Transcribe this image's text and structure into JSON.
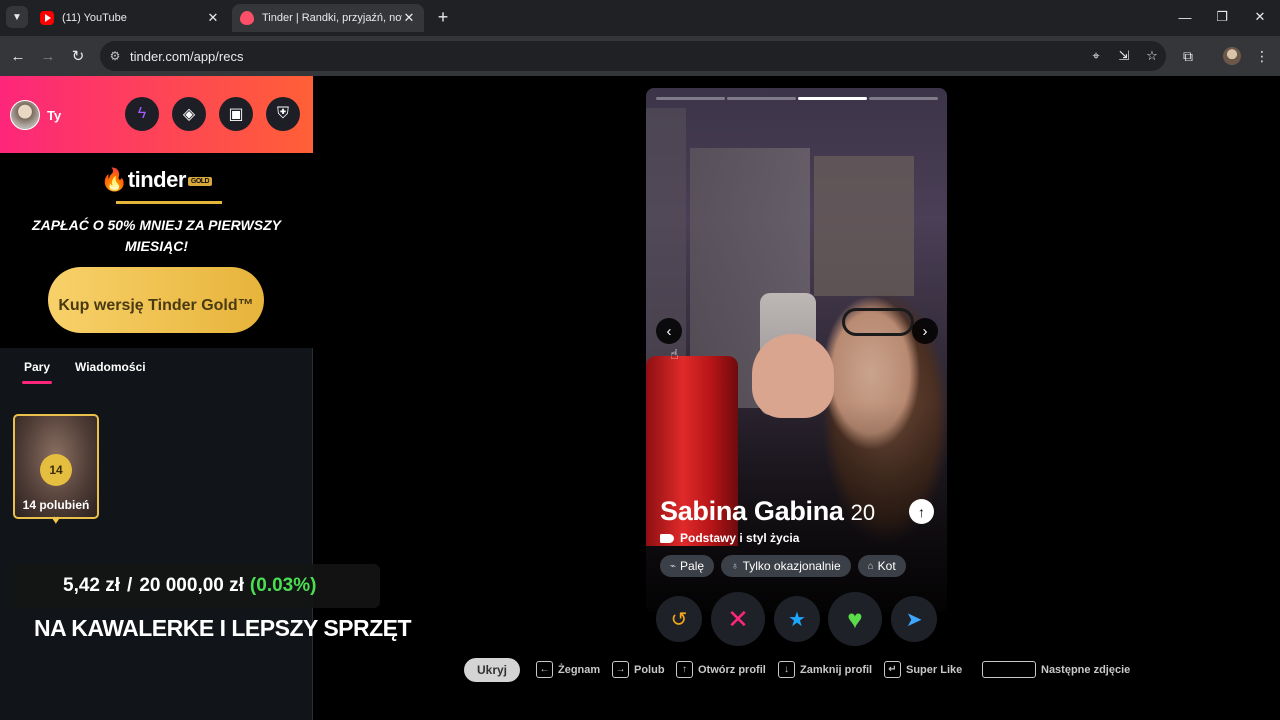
{
  "browser": {
    "tabs": [
      {
        "title": "(11) YouTube",
        "favicon": "youtube-icon"
      },
      {
        "title": "Tinder | Randki, przyjaźń, nowe",
        "favicon": "tinder-flame-icon"
      }
    ],
    "url": "tinder.com/app/recs"
  },
  "sidebar": {
    "user_name": "Ty",
    "header_buttons": [
      "boost-bolt-icon",
      "explore-compass-icon",
      "briefcase-icon",
      "shield-icon"
    ],
    "gold": {
      "logo_text": "tinder",
      "logo_badge": "GOLD",
      "promo": "ZAPŁAĆ O 50% MNIEJ ZA PIERWSZY MIESIĄC!",
      "cta": "Kup wersję Tinder Gold™"
    },
    "tabs": [
      "Pary",
      "Wiadomości"
    ],
    "likes": {
      "count": "14",
      "label": "14 polubień"
    }
  },
  "overlay": {
    "donation_current": "5,42 zł",
    "donation_sep": "/",
    "donation_goal": "20 000,00 zł",
    "donation_pct": "(0.03%)",
    "banner": "NA KAWALERKE I LEPSZY SPRZĘT"
  },
  "profile": {
    "name": "Sabina Gabina",
    "age": "20",
    "section": "Podstawy i styl życia",
    "photo_count": 4,
    "photo_active": 3,
    "chips": [
      {
        "icon": "cigarette-icon",
        "label": "Palę"
      },
      {
        "icon": "glass-icon",
        "label": "Tylko okazjonalnie"
      },
      {
        "icon": "cat-icon",
        "label": "Kot"
      }
    ]
  },
  "actions": {
    "rewind": "↺",
    "nope": "✕",
    "superlike": "★",
    "like": "♥",
    "boost": "➤"
  },
  "colors": {
    "rewind": "#f3a71b",
    "nope": "#fd267a",
    "superlike": "#1ea6ff",
    "like": "#5cdb4a",
    "boost": "#3da7ff"
  },
  "shortcuts": {
    "hide": "Ukryj",
    "items": [
      {
        "key": "←",
        "label": "Żegnam"
      },
      {
        "key": "→",
        "label": "Polub"
      },
      {
        "key": "↑",
        "label": "Otwórz profil"
      },
      {
        "key": "↓",
        "label": "Zamknij profil"
      },
      {
        "key": "↵",
        "label": "Super Like"
      },
      {
        "key": "",
        "label": "Następne zdjęcie"
      }
    ]
  }
}
